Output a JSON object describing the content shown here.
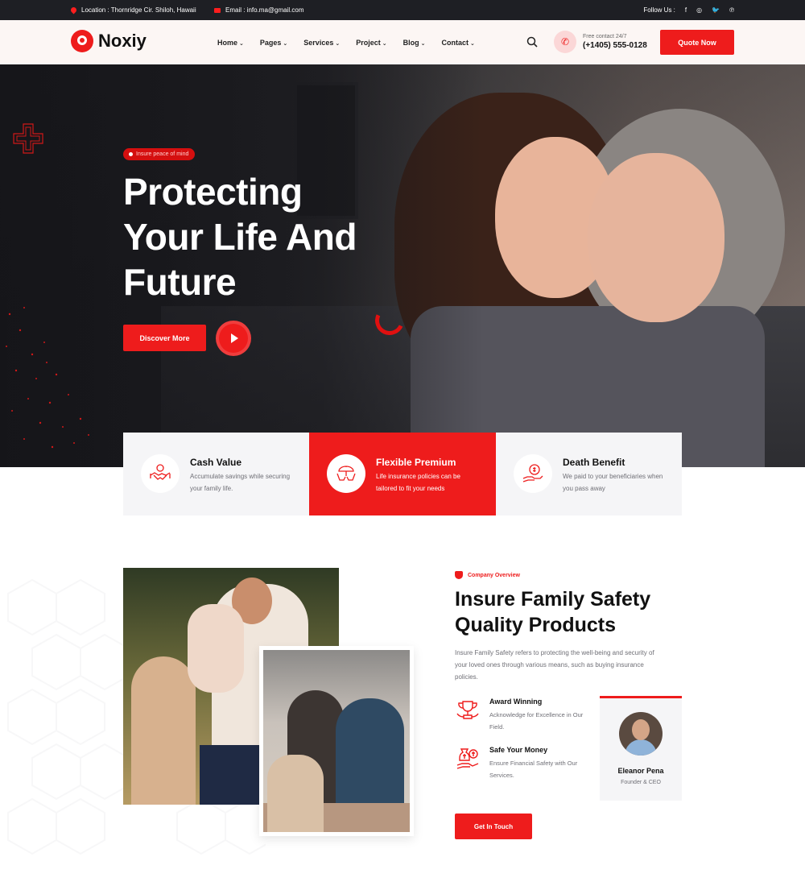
{
  "topbar": {
    "location": "Location : Thornridge Cir. Shiloh, Hawaii",
    "email": "Email : info.ma@gmail.com",
    "follow": "Follow Us :",
    "social": [
      "f",
      "◎",
      "🐦",
      "℗"
    ]
  },
  "header": {
    "brand": "Noxiy",
    "nav": [
      "Home",
      "Pages",
      "Services",
      "Project",
      "Blog",
      "Contact"
    ],
    "contact_label": "Free contact 24/7",
    "contact_phone": "(+1405) 555-0128",
    "quote_label": "Quote Now"
  },
  "hero": {
    "badge": "Insure peace of mind",
    "title": "Protecting Your Life And Future",
    "discover_label": "Discover More"
  },
  "features": [
    {
      "title": "Cash Value",
      "desc": "Accumulate savings while securing your family life.",
      "icon": "handshake-icon"
    },
    {
      "title": "Flexible Premium",
      "desc": "Life insurance policies can be tailored to fit your needs",
      "icon": "umbrella-hands-icon"
    },
    {
      "title": "Death Benefit",
      "desc": "We paid to your beneficiaries when you pass away",
      "icon": "money-hand-icon"
    }
  ],
  "about": {
    "kicker": "Company Overview",
    "title": "Insure Family Safety Quality Products",
    "text": "Insure Family Safety refers to protecting the well-being and security of your loved ones through various means, such as buying insurance policies.",
    "points": [
      {
        "title": "Award Winning",
        "desc": "Acknowledge for Excellence in Our Field."
      },
      {
        "title": "Safe Your Money",
        "desc": "Ensure Financial Safety with Our Services."
      }
    ],
    "person_name": "Eleanor Pena",
    "person_role": "Founder & CEO",
    "cta_label": "Get In Touch"
  },
  "colors": {
    "accent": "#ee1c1c",
    "dark": "#1e1f24"
  }
}
